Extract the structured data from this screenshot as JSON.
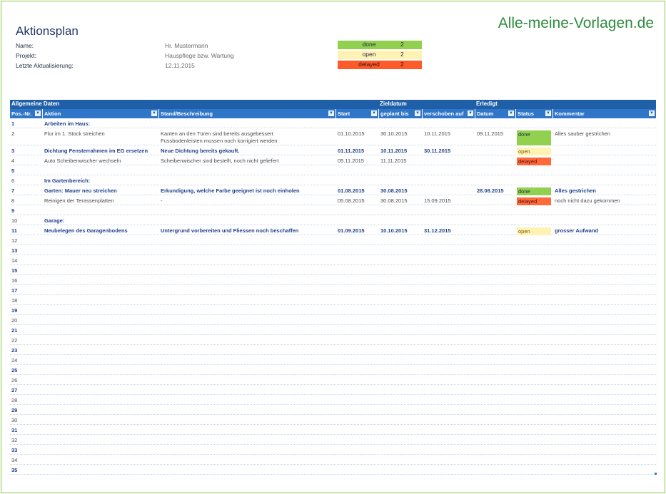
{
  "title": "Aktionsplan",
  "brand": "Alle-meine-Vorlagen.de",
  "meta": {
    "name_label": "Name:",
    "name_value": "Hr. Mustermann",
    "project_label": "Projekt:",
    "project_value": "Hauspflege bzw. Wartung",
    "updated_label": "Letzte Aktualisierung:",
    "updated_value": "12.11.2015"
  },
  "summary": [
    {
      "label": "done",
      "count": "2"
    },
    {
      "label": "open",
      "count": "2"
    },
    {
      "label": "delayed",
      "count": "2"
    }
  ],
  "groups": {
    "general": "Allgemeine Daten",
    "target": "Zieldatum",
    "done": "Erledigt"
  },
  "columns": {
    "pos": "Pos.-Nr.",
    "action": "Aktion",
    "desc": "Stand/Beschreibung",
    "start": "Start",
    "planned": "geplant bis",
    "postponed": "verschoben auf",
    "date": "Datum",
    "status": "Status",
    "comment": "Kommentar"
  },
  "rows": [
    {
      "num": "1",
      "action": "Arbeiten im Haus:",
      "desc": "",
      "desc2": "",
      "start": "",
      "planned": "",
      "postponed": "",
      "date": "",
      "status": "",
      "comment": ""
    },
    {
      "num": "2",
      "action": "Flur im 1. Stock streichen",
      "desc": "Kanten an den Türen sind bereits ausgebessert",
      "desc2": "Fussbodenleisten mussen noch korrigiert werden",
      "start": "01.10.2015",
      "planned": "30.10.2015",
      "postponed": "10.11.2015",
      "date": "09.11.2015",
      "status": "done",
      "comment": "Alles sauber gestrichen"
    },
    {
      "num": "3",
      "action": "Dichtung Fensterrahmen im EG ersetzen",
      "desc": "Neue Dichtung bereits gekauft.",
      "desc2": "",
      "start": "01.11.2015",
      "planned": "10.11.2015",
      "postponed": "30.11.2015",
      "date": "",
      "status": "open",
      "comment": ""
    },
    {
      "num": "4",
      "action": "Auto Scheibenwischer wechseln",
      "desc": "Scheibenwischer sind bestellt, noch nicht geliefert",
      "desc2": "",
      "start": "05.11.2015",
      "planned": "11.11.2015",
      "postponed": "",
      "date": "",
      "status": "delayed",
      "comment": ""
    },
    {
      "num": "5",
      "action": "",
      "desc": "",
      "desc2": "",
      "start": "",
      "planned": "",
      "postponed": "",
      "date": "",
      "status": "",
      "comment": ""
    },
    {
      "num": "6",
      "action": "Im Gartenbereich:",
      "desc": "",
      "desc2": "",
      "start": "",
      "planned": "",
      "postponed": "",
      "date": "",
      "status": "",
      "comment": ""
    },
    {
      "num": "7",
      "action": "Garten: Mauer neu streichen",
      "desc": "Erkundigung, welche Farbe geeignet ist noch einholen",
      "desc2": "",
      "start": "01.08.2015",
      "planned": "30.08.2015",
      "postponed": "",
      "date": "28.08.2015",
      "status": "done",
      "comment": "Alles gestrichen"
    },
    {
      "num": "8",
      "action": "Reinigen der Terassenplatten",
      "desc": "-",
      "desc2": "",
      "start": "05.08.2015",
      "planned": "30.08.2015",
      "postponed": "15.09.2015",
      "date": "",
      "status": "delayed",
      "comment": "noch nicht dazu gekommen"
    },
    {
      "num": "9",
      "action": "",
      "desc": "",
      "desc2": "",
      "start": "",
      "planned": "",
      "postponed": "",
      "date": "",
      "status": "",
      "comment": ""
    },
    {
      "num": "10",
      "action": "Garage:",
      "desc": "",
      "desc2": "",
      "start": "",
      "planned": "",
      "postponed": "",
      "date": "",
      "status": "",
      "comment": ""
    },
    {
      "num": "11",
      "action": "Neubelegen des Garagenbodens",
      "desc": "Untergrund vorbereiten und Fliessen noch beschaffen",
      "desc2": "",
      "start": "01.09.2015",
      "planned": "10.10.2015",
      "postponed": "31.12.2015",
      "date": "",
      "status": "open",
      "comment": "grosser Aufwand"
    }
  ],
  "empty_rows": [
    "12",
    "13",
    "14",
    "15",
    "16",
    "17",
    "18",
    "19",
    "20",
    "21",
    "22",
    "23",
    "24",
    "25",
    "26",
    "27",
    "28",
    "29",
    "30",
    "31",
    "32",
    "33",
    "34",
    "35"
  ],
  "colors": {
    "header_dark": "#1f5fa8",
    "header_light": "#2f76c9",
    "done": "#92d050",
    "open": "#fff2b3",
    "delayed": "#ff5a2a",
    "brand": "#2e8b3e"
  }
}
